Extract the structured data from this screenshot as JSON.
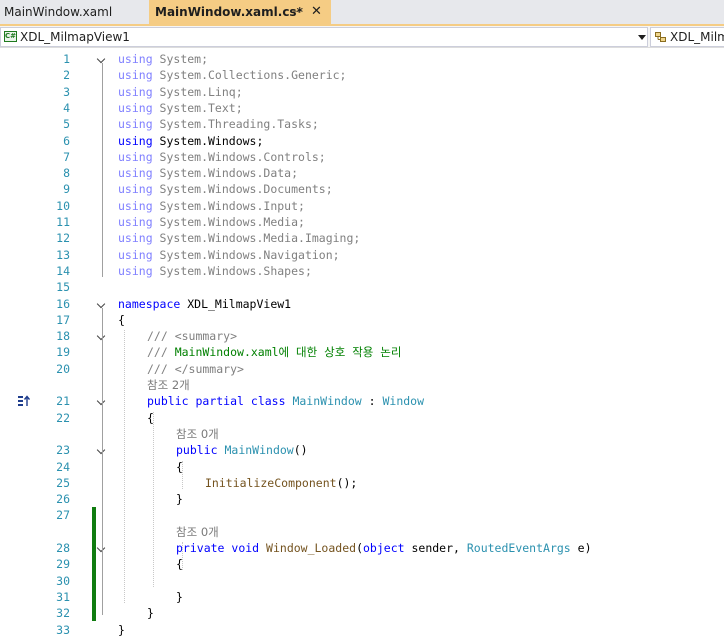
{
  "tabs": [
    {
      "label": "MainWindow.xaml",
      "active": false
    },
    {
      "label": "MainWindow.xaml.cs*",
      "active": true,
      "pin": "⊸",
      "close": "✕"
    }
  ],
  "navbar": {
    "project": "XDL_MilmapView1",
    "project_icon": "C#",
    "member": "XDL_Milm"
  },
  "colors": {
    "keyword": "#0000ff",
    "type": "#2b91af",
    "comment": "#008000",
    "line_number": "#2b91af",
    "change_bar": "#107c10",
    "active_tab": "#f5cc84"
  },
  "editor": {
    "lines": [
      {
        "n": "1",
        "fold": true,
        "tokens": [
          {
            "c": "kw-dim",
            "t": "using"
          },
          {
            "c": "ns-dim",
            "t": " System;"
          }
        ]
      },
      {
        "n": "2",
        "tokens": [
          {
            "c": "kw-dim",
            "t": "using"
          },
          {
            "c": "ns-dim",
            "t": " System.Collections.Generic;"
          }
        ]
      },
      {
        "n": "3",
        "tokens": [
          {
            "c": "kw-dim",
            "t": "using"
          },
          {
            "c": "ns-dim",
            "t": " System.Linq;"
          }
        ]
      },
      {
        "n": "4",
        "tokens": [
          {
            "c": "kw-dim",
            "t": "using"
          },
          {
            "c": "ns-dim",
            "t": " System.Text;"
          }
        ]
      },
      {
        "n": "5",
        "tokens": [
          {
            "c": "kw-dim",
            "t": "using"
          },
          {
            "c": "ns-dim",
            "t": " System.Threading.Tasks;"
          }
        ]
      },
      {
        "n": "6",
        "tokens": [
          {
            "c": "kw",
            "t": "using"
          },
          {
            "c": "",
            "t": " System.Windows;"
          }
        ]
      },
      {
        "n": "7",
        "tokens": [
          {
            "c": "kw-dim",
            "t": "using"
          },
          {
            "c": "ns-dim",
            "t": " System.Windows.Controls;"
          }
        ]
      },
      {
        "n": "8",
        "tokens": [
          {
            "c": "kw-dim",
            "t": "using"
          },
          {
            "c": "ns-dim",
            "t": " System.Windows.Data;"
          }
        ]
      },
      {
        "n": "9",
        "tokens": [
          {
            "c": "kw-dim",
            "t": "using"
          },
          {
            "c": "ns-dim",
            "t": " System.Windows.Documents;"
          }
        ]
      },
      {
        "n": "10",
        "tokens": [
          {
            "c": "kw-dim",
            "t": "using"
          },
          {
            "c": "ns-dim",
            "t": " System.Windows.Input;"
          }
        ]
      },
      {
        "n": "11",
        "tokens": [
          {
            "c": "kw-dim",
            "t": "using"
          },
          {
            "c": "ns-dim",
            "t": " System.Windows.Media;"
          }
        ]
      },
      {
        "n": "12",
        "tokens": [
          {
            "c": "kw-dim",
            "t": "using"
          },
          {
            "c": "ns-dim",
            "t": " System.Windows.Media.Imaging;"
          }
        ]
      },
      {
        "n": "13",
        "tokens": [
          {
            "c": "kw-dim",
            "t": "using"
          },
          {
            "c": "ns-dim",
            "t": " System.Windows.Navigation;"
          }
        ]
      },
      {
        "n": "14",
        "tokens": [
          {
            "c": "kw-dim",
            "t": "using"
          },
          {
            "c": "ns-dim",
            "t": " System.Windows.Shapes;"
          }
        ]
      },
      {
        "n": "15",
        "tokens": []
      },
      {
        "n": "16",
        "fold": true,
        "tokens": [
          {
            "c": "kw",
            "t": "namespace"
          },
          {
            "c": "",
            "t": " XDL_MilmapView1"
          }
        ]
      },
      {
        "n": "17",
        "tokens": [
          {
            "c": "",
            "t": "{"
          }
        ]
      },
      {
        "n": "18",
        "fold": true,
        "indent": 1,
        "tokens": [
          {
            "c": "cmt-dim",
            "t": "/// <summary>"
          }
        ]
      },
      {
        "n": "19",
        "indent": 1,
        "tokens": [
          {
            "c": "cmt-dim",
            "t": "/// "
          },
          {
            "c": "cmt",
            "t": "MainWindow.xaml에 대한 상호 작용 논리"
          }
        ]
      },
      {
        "n": "20",
        "indent": 1,
        "tokens": [
          {
            "c": "cmt-dim",
            "t": "/// </summary>"
          }
        ]
      },
      {
        "ref": "참조 2개",
        "indent": 1
      },
      {
        "n": "21",
        "fold": true,
        "glyph": true,
        "indent": 1,
        "tokens": [
          {
            "c": "kw",
            "t": "public"
          },
          {
            "c": "",
            "t": " "
          },
          {
            "c": "kw",
            "t": "partial"
          },
          {
            "c": "",
            "t": " "
          },
          {
            "c": "kw",
            "t": "class"
          },
          {
            "c": "",
            "t": " "
          },
          {
            "c": "type",
            "t": "MainWindow"
          },
          {
            "c": "",
            "t": " : "
          },
          {
            "c": "type",
            "t": "Window"
          }
        ]
      },
      {
        "n": "22",
        "indent": 1,
        "tokens": [
          {
            "c": "",
            "t": "{"
          }
        ]
      },
      {
        "ref": "참조 0개",
        "indent": 2
      },
      {
        "n": "23",
        "fold": true,
        "indent": 2,
        "tokens": [
          {
            "c": "kw",
            "t": "public"
          },
          {
            "c": "",
            "t": " "
          },
          {
            "c": "type",
            "t": "MainWindow"
          },
          {
            "c": "",
            "t": "()"
          }
        ]
      },
      {
        "n": "24",
        "indent": 2,
        "tokens": [
          {
            "c": "",
            "t": "{"
          }
        ]
      },
      {
        "n": "25",
        "indent": 3,
        "tokens": [
          {
            "c": "method",
            "t": "InitializeComponent"
          },
          {
            "c": "",
            "t": "();"
          }
        ]
      },
      {
        "n": "26",
        "indent": 2,
        "tokens": [
          {
            "c": "",
            "t": "}"
          }
        ]
      },
      {
        "n": "27",
        "change": true,
        "tokens": []
      },
      {
        "ref": "참조 0개",
        "indent": 2,
        "change": true
      },
      {
        "n": "28",
        "fold": true,
        "change": true,
        "indent": 2,
        "tokens": [
          {
            "c": "kw",
            "t": "private"
          },
          {
            "c": "",
            "t": " "
          },
          {
            "c": "kw",
            "t": "void"
          },
          {
            "c": "",
            "t": " "
          },
          {
            "c": "method",
            "t": "Window_Loaded"
          },
          {
            "c": "",
            "t": "("
          },
          {
            "c": "kw",
            "t": "object"
          },
          {
            "c": "",
            "t": " sender, "
          },
          {
            "c": "type",
            "t": "RoutedEventArgs"
          },
          {
            "c": "",
            "t": " e)"
          }
        ]
      },
      {
        "n": "29",
        "change": true,
        "indent": 2,
        "tokens": [
          {
            "c": "",
            "t": "{"
          }
        ]
      },
      {
        "n": "30",
        "change": true,
        "tokens": []
      },
      {
        "n": "31",
        "change": true,
        "indent": 2,
        "tokens": [
          {
            "c": "",
            "t": "}"
          }
        ]
      },
      {
        "n": "32",
        "change": true,
        "indent": 1,
        "tokens": [
          {
            "c": "",
            "t": "}"
          }
        ]
      },
      {
        "n": "33",
        "tokens": [
          {
            "c": "",
            "t": "}"
          }
        ]
      }
    ]
  }
}
